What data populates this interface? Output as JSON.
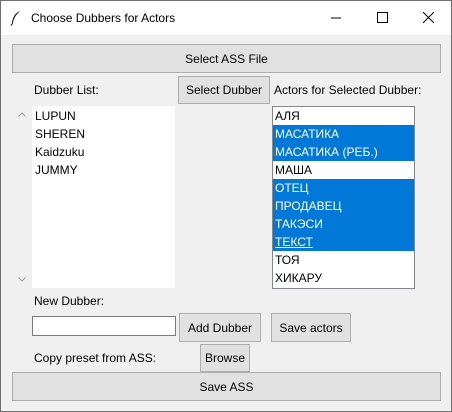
{
  "window": {
    "title": "Choose Dubbers for Actors"
  },
  "buttons": {
    "select_ass": "Select ASS File",
    "select_dubber": "Select Dubber",
    "add_dubber": "Add Dubber",
    "save_actors": "Save actors",
    "browse": "Browse",
    "save_ass": "Save ASS"
  },
  "labels": {
    "dubber_list": "Dubber List:",
    "actors_for_selected": "Actors for Selected Dubber:",
    "new_dubber": "New Dubber:",
    "copy_preset": "Copy preset from ASS:"
  },
  "new_dubber_input": {
    "value": ""
  },
  "dubbers": [
    {
      "name": "LUPUN"
    },
    {
      "name": "SHEREN"
    },
    {
      "name": "Kaidzuku"
    },
    {
      "name": "JUMMY"
    }
  ],
  "actors": [
    {
      "name": "АЛЯ",
      "selected": false
    },
    {
      "name": "МАСАТИКА",
      "selected": true
    },
    {
      "name": "МАСАТИКА (РЕБ.)",
      "selected": true
    },
    {
      "name": "МАША",
      "selected": false
    },
    {
      "name": "ОТЕЦ",
      "selected": true
    },
    {
      "name": "ПРОДАВЕЦ",
      "selected": true
    },
    {
      "name": "ТАКЭСИ",
      "selected": true
    },
    {
      "name": "ТЕКСТ",
      "selected": true
    },
    {
      "name": "ТОЯ",
      "selected": false
    },
    {
      "name": "ХИКАРУ",
      "selected": false
    }
  ],
  "colors": {
    "selection": "#0078d7",
    "window_bg": "#f0f0f0"
  }
}
